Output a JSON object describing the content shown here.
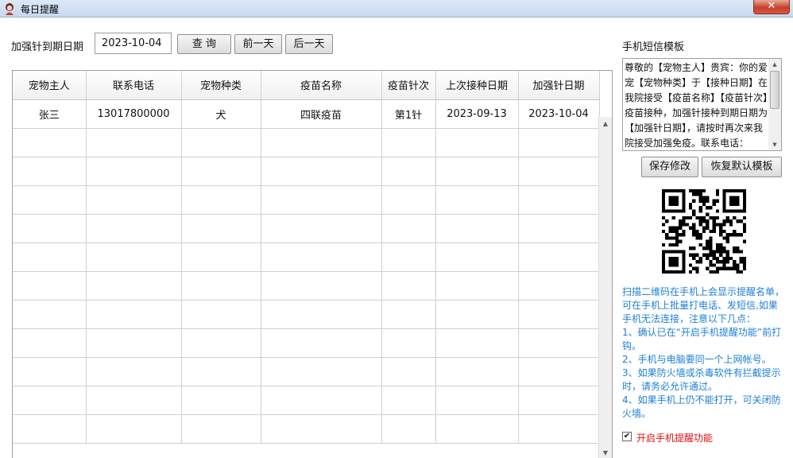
{
  "window": {
    "title": "每日提醒",
    "close_symbol": "✕",
    "icon": "app-icon"
  },
  "toolbar": {
    "date_label": "加强针到期日期",
    "date_value": "2023-10-04",
    "query_label": "查 询",
    "prev_day_label": "前一天",
    "next_day_label": "后一天"
  },
  "table": {
    "columns": [
      "宠物主人",
      "联系电话",
      "宠物种类",
      "疫苗名称",
      "疫苗针次",
      "上次接种日期",
      "加强针日期"
    ],
    "rows": [
      [
        "张三",
        "13017800000",
        "犬",
        "四联疫苗",
        "第1针",
        "2023-09-13",
        "2023-10-04"
      ]
    ],
    "empty_rows": 11
  },
  "sms": {
    "title": "手机短信模板",
    "template_text": "尊敬的【宠物主人】贵宾：你的爱宠【宠物种类】于【接种日期】在我院接受【疫苗名称】【疫苗针次】疫苗接种，加强针接种到期日期为【加强针日期】，请按时再次来我院接受加强免疫。联系电话：",
    "save_label": "保存修改",
    "restore_label": "恢复默认模板"
  },
  "help": {
    "lines": [
      "扫描二维码在手机上会显示提醒名单，可在手机上批量打电话、发短信,如果手机无法连接，注意以下几点：",
      "1、确认已在“开启手机提醒功能”前打钩。",
      "2、手机与电脑要同一个上网帐号。",
      "3、如果防火墙或杀毒软件有拦截提示时，请务必允许通过。",
      "4、如果手机上仍不能打开，可关闭防火墙。"
    ]
  },
  "mobile_reminder": {
    "label": "开启手机提醒功能",
    "checked": true,
    "check_mark": "✔"
  },
  "colors": {
    "help_text": "#1e7fd6",
    "checkbox_label": "#e01010",
    "close_button": "#c7402b"
  }
}
